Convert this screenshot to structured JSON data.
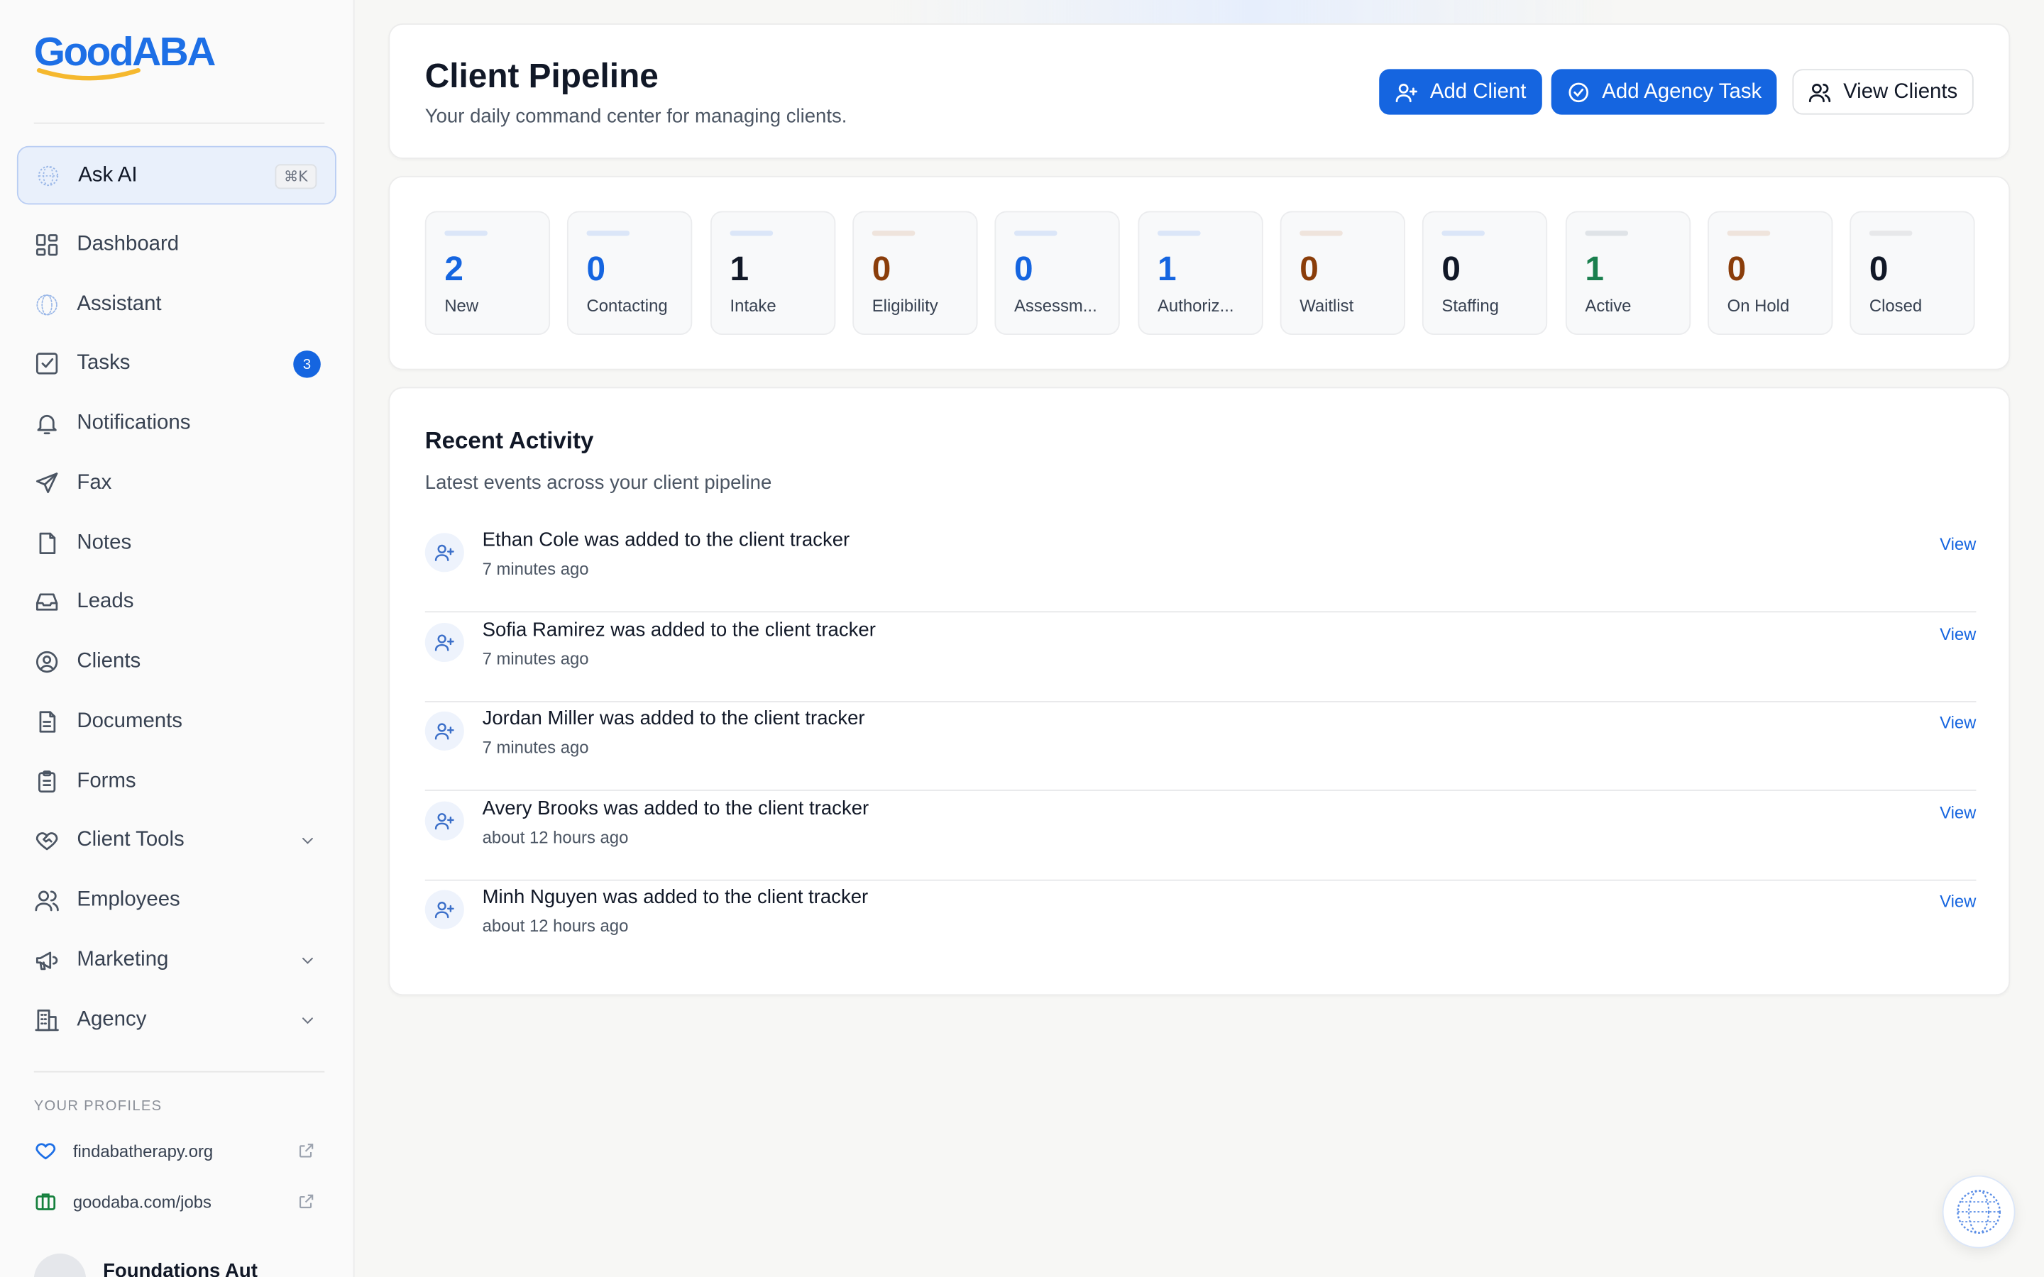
{
  "brand": {
    "good": "Good",
    "aba": "ABA"
  },
  "ask_ai": {
    "label": "Ask AI",
    "shortcut": "⌘K"
  },
  "nav": [
    {
      "label": "Dashboard",
      "icon": "grid-icon"
    },
    {
      "label": "Assistant",
      "icon": "globe-icon"
    },
    {
      "label": "Tasks",
      "icon": "check-square-icon",
      "badge": "3"
    },
    {
      "label": "Notifications",
      "icon": "bell-icon"
    },
    {
      "label": "Fax",
      "icon": "send-icon"
    },
    {
      "label": "Notes",
      "icon": "file-icon"
    },
    {
      "label": "Leads",
      "icon": "inbox-icon"
    },
    {
      "label": "Clients",
      "icon": "user-circle-icon"
    },
    {
      "label": "Documents",
      "icon": "file-text-icon"
    },
    {
      "label": "Forms",
      "icon": "clipboard-icon"
    },
    {
      "label": "Client Tools",
      "icon": "heart-handshake-icon",
      "expandable": true
    },
    {
      "label": "Employees",
      "icon": "users-icon"
    },
    {
      "label": "Marketing",
      "icon": "megaphone-icon",
      "expandable": true
    },
    {
      "label": "Agency",
      "icon": "building-icon",
      "expandable": true
    }
  ],
  "profiles": {
    "heading": "YOUR PROFILES",
    "items": [
      {
        "label": "findabatherapy.org",
        "icon": "heart-icon",
        "color": "#1d6fe6"
      },
      {
        "label": "goodaba.com/jobs",
        "icon": "briefcase-icon",
        "color": "#15803d"
      }
    ]
  },
  "account": {
    "name": "Foundations Aut"
  },
  "header": {
    "title": "Client Pipeline",
    "subtitle": "Your daily command center for managing clients.",
    "buttons": {
      "add_client": "Add Client",
      "add_task": "Add Agency Task",
      "view_clients": "View Clients"
    }
  },
  "stages": [
    {
      "count": "2",
      "label": "New",
      "color": "#1565e0",
      "bar": "#dbe6f8"
    },
    {
      "count": "0",
      "label": "Contacting",
      "color": "#1565e0",
      "bar": "#dbe6f8"
    },
    {
      "count": "1",
      "label": "Intake",
      "color": "#111827",
      "bar": "#dbe6f8"
    },
    {
      "count": "0",
      "label": "Eligibility",
      "color": "#8a3d0a",
      "bar": "#efe4dc"
    },
    {
      "count": "0",
      "label": "Assessm...",
      "color": "#1565e0",
      "bar": "#dbe6f8"
    },
    {
      "count": "1",
      "label": "Authoriz...",
      "color": "#1565e0",
      "bar": "#dbe6f8"
    },
    {
      "count": "0",
      "label": "Waitlist",
      "color": "#8a3d0a",
      "bar": "#efe4dc"
    },
    {
      "count": "0",
      "label": "Staffing",
      "color": "#111827",
      "bar": "#dbe6f8"
    },
    {
      "count": "1",
      "label": "Active",
      "color": "#1a7f4e",
      "bar": "#dfe3e7"
    },
    {
      "count": "0",
      "label": "On Hold",
      "color": "#8a3d0a",
      "bar": "#efe4dc"
    },
    {
      "count": "0",
      "label": "Closed",
      "color": "#111827",
      "bar": "#e7e8ea"
    }
  ],
  "activity": {
    "title": "Recent Activity",
    "subtitle": "Latest events across your client pipeline",
    "view_label": "View",
    "items": [
      {
        "text": "Ethan Cole was added to the client tracker",
        "time": "7 minutes ago"
      },
      {
        "text": "Sofia Ramirez was added to the client tracker",
        "time": "7 minutes ago"
      },
      {
        "text": "Jordan Miller was added to the client tracker",
        "time": "7 minutes ago"
      },
      {
        "text": "Avery Brooks was added to the client tracker",
        "time": "about 12 hours ago"
      },
      {
        "text": "Minh Nguyen was added to the client tracker",
        "time": "about 12 hours ago"
      }
    ]
  }
}
